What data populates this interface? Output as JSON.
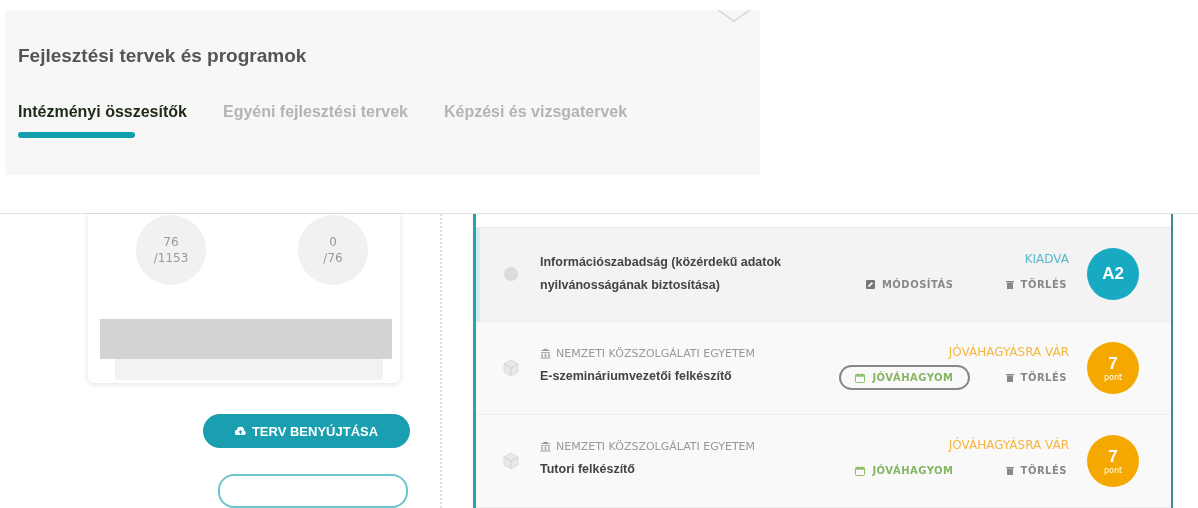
{
  "header": {
    "title": "Fejlesztési tervek és programok"
  },
  "tabs": [
    {
      "label": "Intézményi összesítők",
      "selected": true
    },
    {
      "label": "Egyéni fejlesztési tervek",
      "selected": false
    },
    {
      "label": "Képzési és vizsgatervek",
      "selected": false
    }
  ],
  "summary": {
    "counters": [
      {
        "value": "76",
        "total": "/1153"
      },
      {
        "value": "0",
        "total": "/76"
      }
    ]
  },
  "submit_button": "TERV BENYÚJTÁSA",
  "plans": [
    {
      "kind": "issued",
      "selected": true,
      "title": "Információszabadság (közérdekű adatok nyilvánosságának biztosítása)",
      "status": "KIADVA",
      "actions": [
        {
          "kind": "edit",
          "label": "MÓDOSÍTÁS",
          "focused": false
        },
        {
          "kind": "delete",
          "label": "TÖRLÉS",
          "focused": false
        }
      ],
      "badge": "A2"
    },
    {
      "kind": "pending",
      "selected": false,
      "institution": "NEMZETI KÖZSZOLGÁLATI EGYETEM",
      "title": "E-szemináriumvezetői felkészítő",
      "status": "JÓVÁHAGYÁSRA VÁR",
      "actions": [
        {
          "kind": "approve",
          "label": "JÓVÁHAGYOM",
          "focused": true
        },
        {
          "kind": "delete",
          "label": "TÖRLÉS",
          "focused": false
        }
      ],
      "badge": "7",
      "badge_unit": "pont"
    },
    {
      "kind": "pending",
      "selected": false,
      "institution": "NEMZETI KÖZSZOLGÁLATI EGYETEM",
      "title": "Tutori felkészítő",
      "status": "JÓVÁHAGYÁSRA VÁR",
      "actions": [
        {
          "kind": "approve",
          "label": "JÓVÁHAGYOM",
          "focused": false
        },
        {
          "kind": "delete",
          "label": "TÖRLÉS",
          "focused": false
        }
      ],
      "badge": "7",
      "badge_unit": "pont"
    }
  ]
}
